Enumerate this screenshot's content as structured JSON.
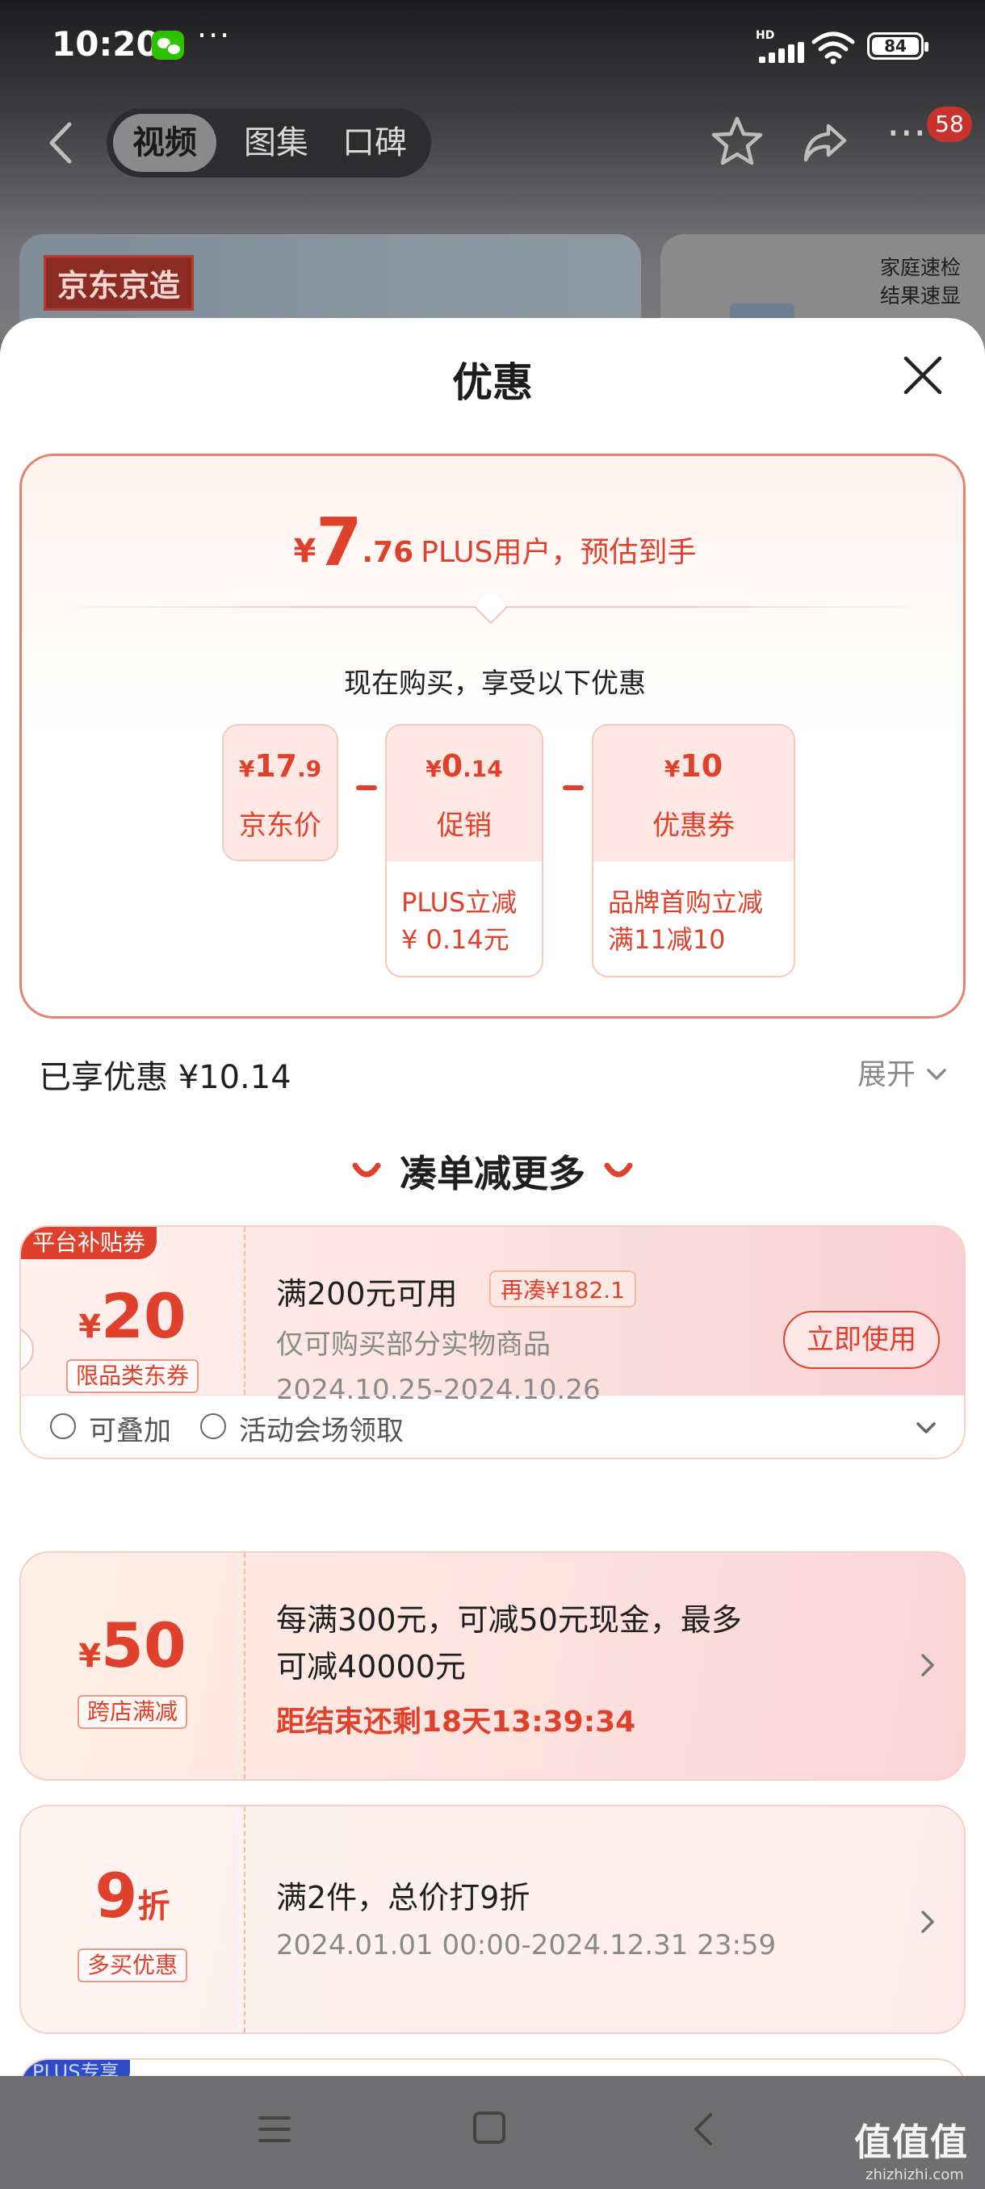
{
  "status_bar": {
    "time": "10:20",
    "more": "···",
    "network": "HD",
    "battery": "84"
  },
  "header": {
    "tabs": [
      "视频",
      "图集",
      "口碑"
    ],
    "more_badge": "58"
  },
  "background": {
    "banner_tag": "京东京造",
    "side_text_1": "家庭速检",
    "side_text_2": "结果速显"
  },
  "sheet": {
    "title": "优惠",
    "headline": {
      "currency": "¥",
      "integer": "7",
      "decimal": ".76",
      "text": "PLUS用户，预估到手"
    },
    "subtitle": "现在购买，享受以下优惠",
    "breakdown": [
      {
        "currency": "¥",
        "amount": "17",
        "decimal": ".9",
        "label": "京东价"
      },
      {
        "currency": "¥",
        "amount": "0",
        "decimal": ".14",
        "label": "促销",
        "desc_1": "PLUS立减",
        "desc_2": "¥ 0.14元"
      },
      {
        "currency": "¥",
        "amount": "10",
        "decimal": "",
        "label": "优惠券",
        "desc_1": "品牌首购立减",
        "desc_2": "满11减10"
      }
    ],
    "enjoyed": "已享优惠 ¥10.14",
    "expand": "展开",
    "section_title": "凑单减更多"
  },
  "coupons": [
    {
      "ribbon": "平台补贴券",
      "currency": "¥",
      "amount": "20",
      "tag": "限品类东券",
      "title": "满200元可用",
      "badge": "再凑¥182.1",
      "desc": "仅可购买部分实物商品",
      "period": "2024.10.25-2024.10.26",
      "button": "立即使用",
      "footer_1": "可叠加",
      "footer_2": "活动会场领取"
    },
    {
      "currency": "¥",
      "amount": "50",
      "tag": "跨店满减",
      "line_1": "每满300元，可减50元现金，最多",
      "line_2": "可减40000元",
      "countdown": "距结束还剩18天13:39:34"
    },
    {
      "amount": "9",
      "unit": "折",
      "tag": "多买优惠",
      "title": "满2件，总价打9折",
      "period": "2024.01.01 00:00-2024.12.31 23:59"
    }
  ],
  "next_card_tag": "PLUS专享",
  "watermark": {
    "logo": "值值值",
    "url": "zhizhizhi.com"
  },
  "colors": {
    "accent": "#e0412c",
    "card_border": "#e4836f",
    "chip_bg": "#fde8e3"
  }
}
